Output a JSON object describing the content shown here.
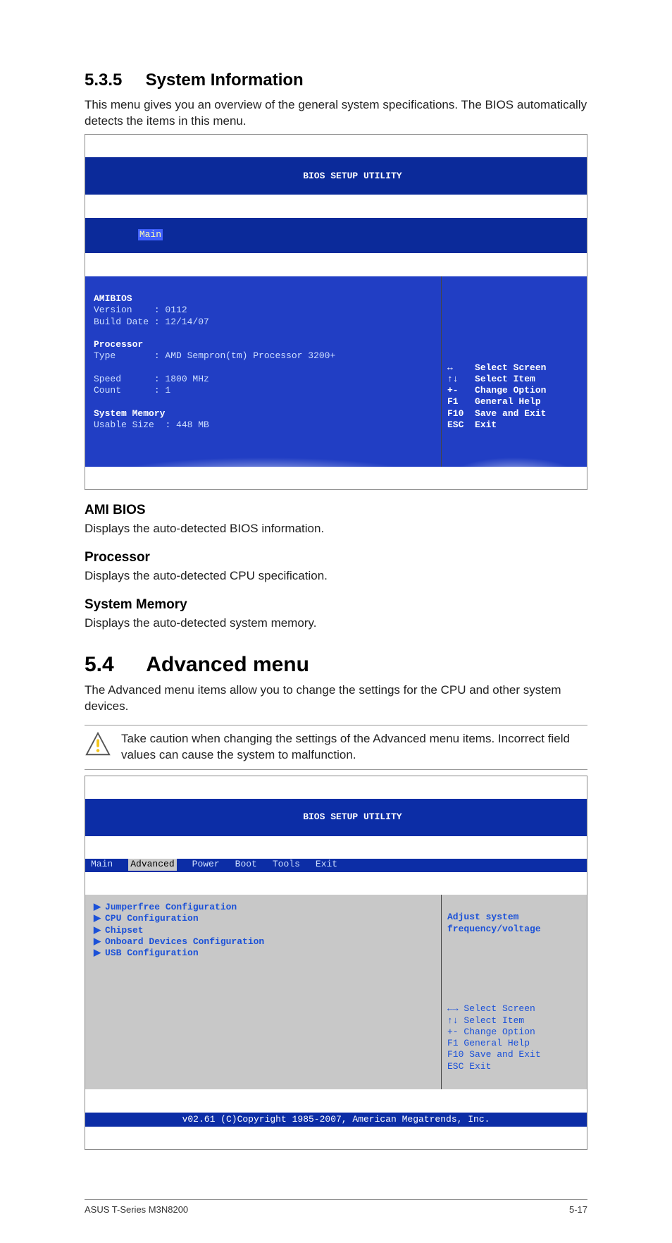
{
  "section535": {
    "num": "5.3.5",
    "title": "System Information",
    "intro": "This menu gives you an overview of the general system specifications. The BIOS automatically detects the items in this menu."
  },
  "bios1": {
    "title": "BIOS SETUP UTILITY",
    "tab_main": "Main",
    "left": {
      "amibios": "AMIBIOS",
      "version_label": "Version",
      "version_value": ": 0112",
      "build_label": "Build Date",
      "build_value": ": 12/14/07",
      "processor": "Processor",
      "type_label": "Type",
      "type_value": ": AMD Sempron(tm) Processor 3200+",
      "speed_label": "Speed",
      "speed_value": ": 1800 MHz",
      "count_label": "Count",
      "count_value": ": 1",
      "sysmem": "System Memory",
      "usable_label": "Usable Size",
      "usable_value": ": 448 MB"
    },
    "help": {
      "k1": "↔",
      "v1": "Select Screen",
      "k2": "↑↓",
      "v2": "Select Item",
      "k3": "+-",
      "v3": "Change Option",
      "k4": "F1",
      "v4": "General Help",
      "k5": "F10",
      "v5": "Save and Exit",
      "k6": "ESC",
      "v6": "Exit"
    }
  },
  "ami_h": "AMI BIOS",
  "ami_p": "Displays the auto-detected BIOS information.",
  "proc_h": "Processor",
  "proc_p": "Displays the auto-detected CPU specification.",
  "mem_h": "System Memory",
  "mem_p": "Displays the auto-detected system memory.",
  "section54": {
    "num": "5.4",
    "title": "Advanced menu",
    "intro": "The Advanced menu items allow you to change the settings for the CPU and other system devices."
  },
  "caution": "Take caution when changing the settings of the Advanced menu items. Incorrect field values can cause the system to malfunction.",
  "bios2": {
    "title": "BIOS SETUP UTILITY",
    "tabs": {
      "main": "Main",
      "advanced": "Advanced",
      "power": "Power",
      "boot": "Boot",
      "tools": "Tools",
      "exit": "Exit"
    },
    "menu": {
      "i1": "Jumperfree Configuration",
      "i2": "CPU Configuration",
      "i3": "Chipset",
      "i4": "Onboard Devices Configuration",
      "i5": "USB Configuration"
    },
    "hint1": "Adjust system",
    "hint2": "frequency/voltage",
    "help": {
      "k1": "←→",
      "v1": "Select Screen",
      "k2": "↑↓",
      "v2": "Select Item",
      "k3": "+-",
      "v3": "Change Option",
      "k4": "F1",
      "v4": "General Help",
      "k5": "F10",
      "v5": "Save and Exit",
      "k6": "ESC",
      "v6": "Exit"
    },
    "footer": "v02.61 (C)Copyright 1985-2007, American Megatrends, Inc."
  },
  "pagefooter": {
    "left": "ASUS T-Series M3N8200",
    "right": "5-17"
  }
}
